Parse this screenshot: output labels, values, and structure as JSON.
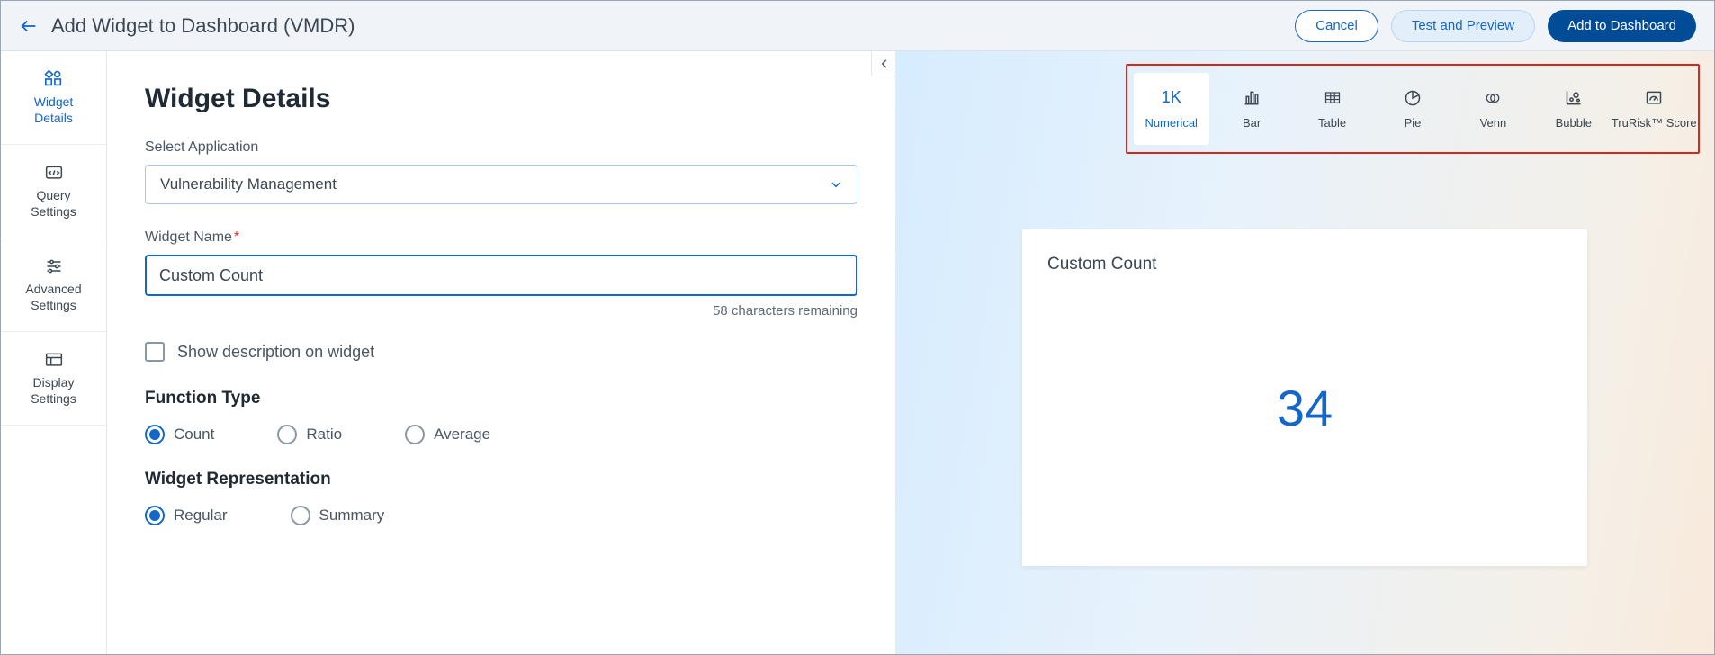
{
  "header": {
    "title": "Add Widget to Dashboard (VMDR)",
    "cancel": "Cancel",
    "test_preview": "Test and Preview",
    "add": "Add to Dashboard"
  },
  "sidebar": {
    "items": [
      {
        "label": "Widget\nDetails"
      },
      {
        "label": "Query\nSettings"
      },
      {
        "label": "Advanced\nSettings"
      },
      {
        "label": "Display\nSettings"
      }
    ]
  },
  "form": {
    "title": "Widget Details",
    "select_app_label": "Select Application",
    "select_app_value": "Vulnerability Management",
    "widget_name_label": "Widget Name",
    "widget_name_value": "Custom Count",
    "chars_remaining": "58 characters remaining",
    "show_desc_label": "Show description on widget",
    "function_type_label": "Function Type",
    "function_options": {
      "count": "Count",
      "ratio": "Ratio",
      "average": "Average"
    },
    "representation_label": "Widget Representation",
    "representation_options": {
      "regular": "Regular",
      "summary": "Summary"
    }
  },
  "types": {
    "numerical": "Numerical",
    "numerical_icon": "1K",
    "bar": "Bar",
    "table": "Table",
    "pie": "Pie",
    "venn": "Venn",
    "bubble": "Bubble",
    "trurisk": "TruRisk™ Score"
  },
  "preview": {
    "title": "Custom Count",
    "value": "34"
  }
}
